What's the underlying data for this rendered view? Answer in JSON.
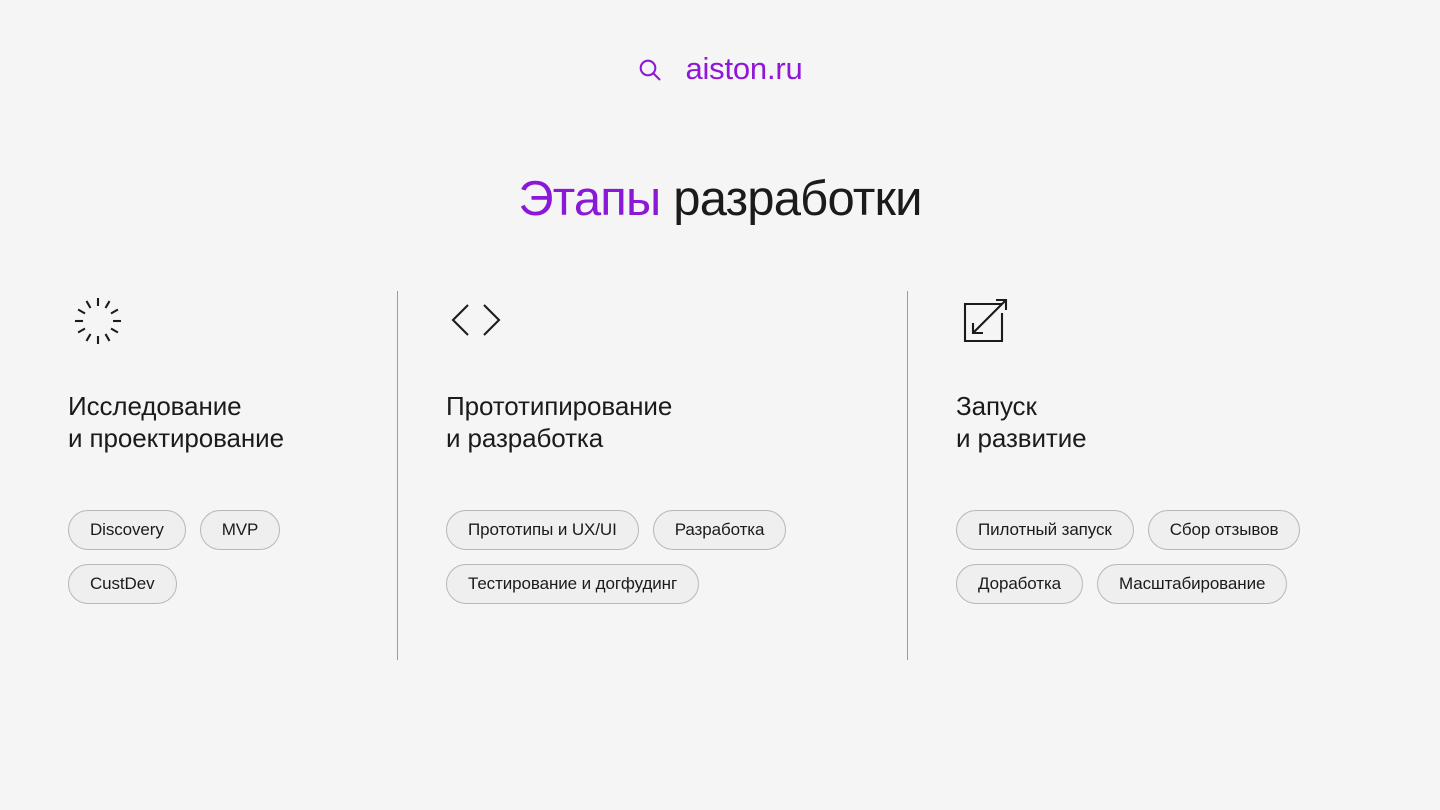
{
  "brand": {
    "icon": "search-icon",
    "name": "aiston.ru",
    "color": "#9017d8"
  },
  "page_title": {
    "accent": "Этапы",
    "accent_color": "#8a18d6",
    "plain": " разработки",
    "full": "Этапы разработки"
  },
  "stages": [
    {
      "icon": "spinner-icon",
      "title": "Исследование\nи проектирование",
      "tags": [
        "Discovery",
        "MVP",
        "CustDev"
      ]
    },
    {
      "icon": "code-brackets-icon",
      "title": "Прототипирование\nи разработка",
      "tags": [
        "Прототипы и UX/UI",
        "Разработка",
        "Тестирование и догфудинг"
      ]
    },
    {
      "icon": "scale-expand-icon",
      "title": "Запуск\nи развитие",
      "tags": [
        "Пилотный запуск",
        "Сбор отзывов",
        "Доработка",
        "Масштабирование"
      ]
    }
  ],
  "theme": {
    "background": "#f5f5f5",
    "text": "#1b1b1b",
    "tag_background": "#efefef",
    "tag_border": "#b7b7ba",
    "divider": "#9c9ca0"
  }
}
